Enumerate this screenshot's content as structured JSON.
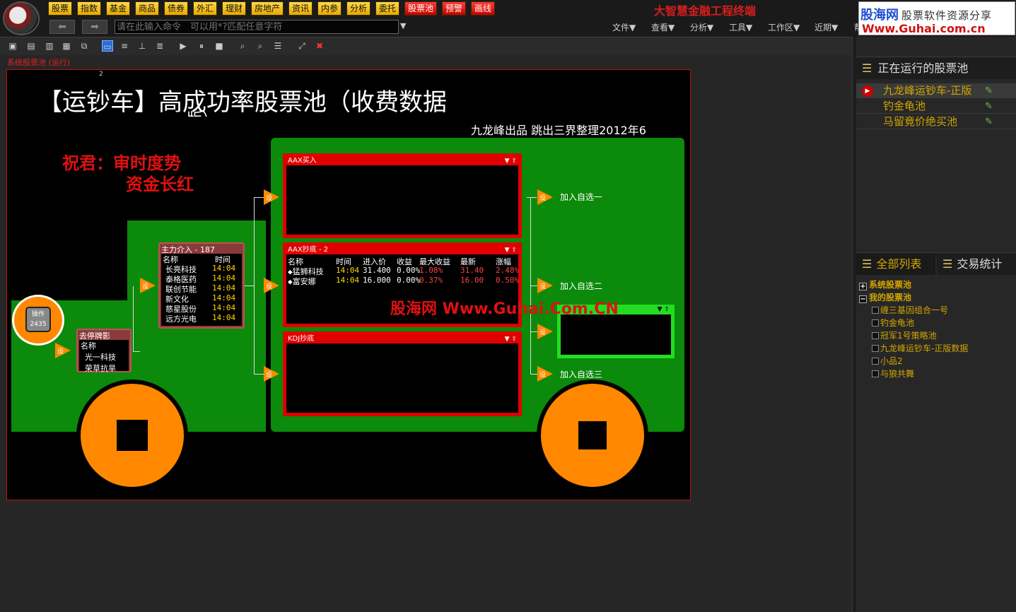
{
  "header": {
    "nav_buttons": [
      {
        "label": "股票",
        "style": "yellow"
      },
      {
        "label": "指数",
        "style": "yellow"
      },
      {
        "label": "基金",
        "style": "yellow"
      },
      {
        "label": "商品",
        "style": "yellow"
      },
      {
        "label": "债券",
        "style": "yellow"
      },
      {
        "label": "外汇",
        "style": "yellow"
      },
      {
        "label": "理财",
        "style": "yellow"
      },
      {
        "label": "房地产",
        "style": "yellow"
      },
      {
        "label": "资讯",
        "style": "yellow"
      },
      {
        "label": "内参",
        "style": "yellow"
      },
      {
        "label": "分析",
        "style": "yellow"
      },
      {
        "label": "委托",
        "style": "yellow"
      },
      {
        "label": "股票池",
        "style": "red"
      },
      {
        "label": "预警",
        "style": "red"
      },
      {
        "label": "画线",
        "style": "red"
      }
    ],
    "app_title": "大智慧金融工程终端",
    "brand_name": "股海网",
    "brand_tagline": "股票软件资源分享",
    "brand_url": "Www.Guhai.com.cn",
    "command_placeholder": "请在此输入命令　可以用*?匹配任意字符",
    "menus": [
      "文件▼",
      "查看▼",
      "分析▼",
      "工具▼",
      "工作区▼",
      "近期▼",
      "帮"
    ]
  },
  "pool_label": "系统股票池 (运行)",
  "canvas": {
    "page_marker": "2",
    "title_line1": "【运钞车】高成功率股票池（收费数据",
    "title_line2_partial": "版）",
    "subtitle": "九龙峰出品 跳出三界整理2012年6",
    "wish_line1": "祝君：审时度势",
    "wish_line2": "资金长红",
    "watermark": "股海网 Www.Guhai.Com.CN",
    "add_labels": [
      "加入自选一",
      "加入自选二",
      "加入自选三"
    ],
    "stock_icon_label": "操作",
    "stock_icon_value": "2435",
    "node_label": "设"
  },
  "pools": {
    "limit_down": {
      "title": "去停牌影",
      "header": "名称",
      "rows": [
        "光一科技",
        "荣草抗旱"
      ]
    },
    "main_force": {
      "title": "主力介入 - 187",
      "columns": [
        "名称",
        "时间"
      ],
      "rows": [
        {
          "name": "长亮科技",
          "time": "14:04"
        },
        {
          "name": "泰格医药",
          "time": "14:04"
        },
        {
          "name": "联创节能",
          "time": "14:04"
        },
        {
          "name": "新文化",
          "time": "14:04"
        },
        {
          "name": "慈星股份",
          "time": "14:04"
        },
        {
          "name": "远方光电",
          "time": "14:04"
        }
      ]
    },
    "aax_buy": {
      "title": "AAX买入"
    },
    "aax_bottom": {
      "title": "AAX抄底 - 2",
      "columns": [
        "名称",
        "时间",
        "进入价",
        "收益",
        "最大收益",
        "最新",
        "涨幅"
      ],
      "rows": [
        {
          "name": "◆猛狮科技",
          "time": "14:04",
          "entry": "31.400",
          "gain": "0.00%",
          "max_gain": "1.08%",
          "last": "31.40",
          "change": "2.48%"
        },
        {
          "name": "◆富安娜",
          "time": "14:04",
          "entry": "16.000",
          "gain": "0.00%",
          "max_gain": "0.37%",
          "last": "16.00",
          "change": "0.50%"
        }
      ]
    },
    "kdj_bottom": {
      "title": "KDJ抄底"
    }
  },
  "right_panel": {
    "running_title": "正在运行的股票池",
    "running_items": [
      "九龙峰运钞车-正版",
      "钓金龟池",
      "马留竟价绝买池"
    ],
    "tabs": [
      "全部列表",
      "交易统计"
    ],
    "tree": {
      "system_pool": "系统股票池",
      "my_pool": "我的股票池",
      "my_items": [
        "缠三基因组合一号",
        "钓金龟池",
        "冠军1号策略池",
        "九龙峰运钞车-正版数据",
        "小品2",
        "与狼共舞"
      ]
    }
  },
  "colors": {
    "accent_red": "#e00000",
    "truck_green": "#0b8a0b",
    "wheel_orange": "#ff8800",
    "pool_gold": "#d2a500"
  }
}
